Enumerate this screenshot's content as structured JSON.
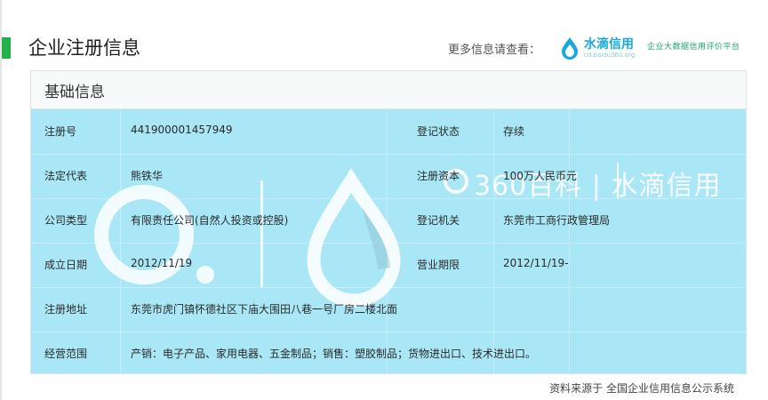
{
  "header": {
    "title": "企业注册信息",
    "more_info_label": "更多信息请查看：",
    "brand": {
      "name": "水滴信用",
      "domain": "cd.baidu360.org",
      "slogan": "企业大数据信用评价平台",
      "icon": "water-drop-icon",
      "color": "#19a9d9"
    }
  },
  "panel": {
    "section_title": "基础信息",
    "watermark": {
      "text": "360百科 | 水滴信用",
      "logo": "360-logo-and-drop-watermark"
    },
    "rows": [
      {
        "label1": "注册号",
        "value1": "441900001457949",
        "label2": "登记状态",
        "value2": "存续"
      },
      {
        "label1": "法定代表",
        "value1": "熊铁华",
        "label2": "注册资本",
        "value2": "100万人民币元"
      },
      {
        "label1": "公司类型",
        "value1": "有限责任公司(自然人投资或控股)",
        "label2": "登记机关",
        "value2": "东莞市工商行政管理局"
      },
      {
        "label1": "成立日期",
        "value1": "2012/11/19",
        "label2": "营业期限",
        "value2": "2012/11/19-"
      },
      {
        "label1": "注册地址",
        "value1": "东莞市虎门镇怀德社区下庙大围田八巷一号厂房二楼北面"
      },
      {
        "label1": "经营范围",
        "value1": "产销：电子产品、家用电器、五金制品；销售：塑胶制品；货物进出口、技术进出口。"
      }
    ]
  },
  "footer": {
    "source_text": "资料来源于 全国企业信用信息公示系统"
  },
  "colors": {
    "accent_green": "#24b14c",
    "table_background": "#a9e6f6",
    "header_background": "#f7faf8"
  }
}
